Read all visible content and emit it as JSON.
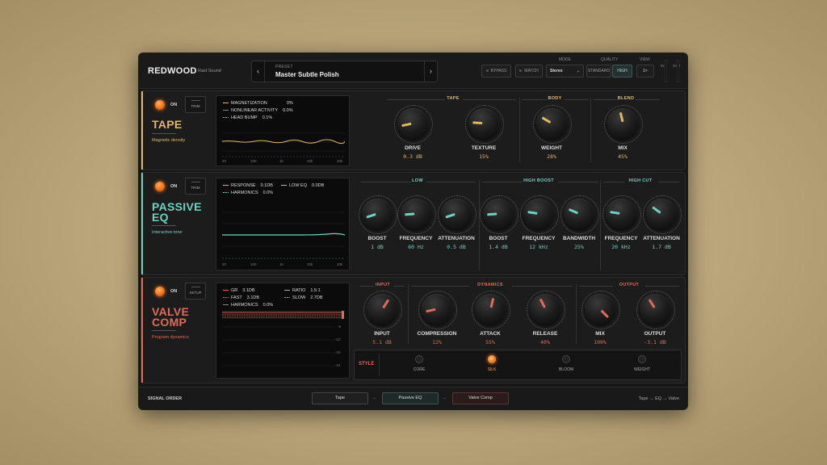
{
  "app": {
    "brand": "REDWOOD",
    "brand_sub": "Rast Sound"
  },
  "preset": {
    "label": "PRESET",
    "name": "Master Subtle Polish",
    "prev_icon": "chevron-left-icon",
    "next_icon": "chevron-right-icon"
  },
  "topbar": {
    "bypass": "BYPASS",
    "match": "MATCH",
    "mode_label": "MODE",
    "mode_value": "Stereo",
    "quality_label": "QUALITY",
    "quality_standard": "STANDARD",
    "quality_high": "HIGH",
    "view_label": "VIEW",
    "view_value": "1×",
    "in_label": "IN",
    "out_label": "OUT"
  },
  "colors": {
    "tape": "#e0b862",
    "eq": "#6fd1c0",
    "comp": "#e06b5a",
    "power": "#ff7a1c"
  },
  "tape": {
    "on": "ON",
    "trim": "TRIM",
    "title": "TAPE",
    "subtitle": "Magnetic density",
    "legend": [
      {
        "name": "MAGNETIZATION",
        "value": "0%"
      },
      {
        "name": "NONLINEAR ACTIVITY",
        "value": "0.0%"
      },
      {
        "name": "HEAD BUMP",
        "value": "0.1%"
      }
    ],
    "freq_ticks": [
      "20",
      "100",
      "1k",
      "10k",
      "20k"
    ],
    "groups": {
      "tape": "TAPE",
      "body": "BODY",
      "blend": "BLEND"
    },
    "knobs": [
      {
        "label": "DRIVE",
        "value": "0.3 dB",
        "level": 0.12
      },
      {
        "label": "TEXTURE",
        "value": "15%",
        "level": 0.18
      },
      {
        "label": "WEIGHT",
        "value": "28%",
        "level": 0.28
      },
      {
        "label": "MIX",
        "value": "45%",
        "level": 0.45
      }
    ]
  },
  "eq": {
    "on": "ON",
    "trim": "TRIM",
    "title1": "PASSIVE",
    "title2": "EQ",
    "subtitle": "Interactive tone",
    "legend": [
      {
        "name": "RESPONSE",
        "value": "0.1DB"
      },
      {
        "name": "LOW EQ",
        "value": "0.0DB"
      },
      {
        "name": "HARMONICS",
        "value": "0.0%"
      }
    ],
    "freq_ticks": [
      "20",
      "100",
      "1k",
      "10k",
      "20k"
    ],
    "groups": {
      "low": "LOW",
      "high_boost": "HIGH BOOST",
      "high_cut": "HIGH CUT"
    },
    "knobs": [
      {
        "label": "BOOST",
        "value": "1 dB",
        "level": 0.1
      },
      {
        "label": "FREQUENCY",
        "value": "60 Hz",
        "level": 0.15
      },
      {
        "label": "ATTENUATION",
        "value": "0.5 dB",
        "level": 0.1
      },
      {
        "label": "BOOST",
        "value": "1.4 dB",
        "level": 0.15
      },
      {
        "label": "FREQUENCY",
        "value": "12 kHz",
        "level": 0.2
      },
      {
        "label": "BANDWIDTH",
        "value": "25%",
        "level": 0.25
      },
      {
        "label": "FREQUENCY",
        "value": "20 kHz",
        "level": 0.2
      },
      {
        "label": "ATTENUATION",
        "value": "1.7 dB",
        "level": 0.3
      }
    ]
  },
  "comp": {
    "on": "ON",
    "setup": "SETUP",
    "title1": "VALVE",
    "title2": "COMP",
    "subtitle": "Program dynamics",
    "legend": [
      {
        "name": "GR",
        "value": "3.1DB"
      },
      {
        "name": "RATIO",
        "value": "1.5:1"
      },
      {
        "name": "FAST",
        "value": "3.1DB"
      },
      {
        "name": "SLOW",
        "value": "2.7DB"
      },
      {
        "name": "HARMONICS",
        "value": "0.0%"
      }
    ],
    "db_ticks": [
      "-6",
      "-12",
      "-18",
      "-24"
    ],
    "groups": {
      "input": "INPUT",
      "dynamics": "DYNAMICS",
      "output": "OUTPUT"
    },
    "knobs": [
      {
        "label": "INPUT",
        "value": "5.1 dB",
        "level": 0.62
      },
      {
        "label": "COMPRESSION",
        "value": "12%",
        "level": 0.12
      },
      {
        "label": "ATTACK",
        "value": "55%",
        "level": 0.55
      },
      {
        "label": "RELEASE",
        "value": "40%",
        "level": 0.4
      },
      {
        "label": "MIX",
        "value": "100%",
        "level": 1.0
      },
      {
        "label": "OUTPUT",
        "value": "-3.1 dB",
        "level": 0.38
      }
    ],
    "style": {
      "label": "STYLE",
      "options": [
        "CORE",
        "SILK",
        "BLOOM",
        "WEIGHT"
      ],
      "selected": "SILK"
    }
  },
  "signal": {
    "title": "SIGNAL ORDER",
    "items": [
      "Tape",
      "Passive EQ",
      "Valve Comp"
    ],
    "summary": "Tape → EQ → Valve"
  }
}
